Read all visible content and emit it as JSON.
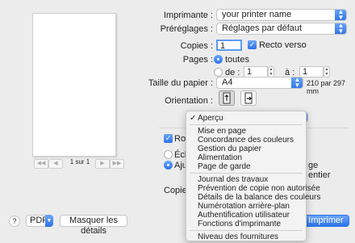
{
  "preview": {
    "page_label": "1 sur 1",
    "first_label": "◀◀",
    "prev_label": "◀",
    "next_label": "▶",
    "last_label": "▶▶"
  },
  "printer": {
    "label": "Imprimante :",
    "value": "your printer name"
  },
  "presets": {
    "label": "Préréglages :",
    "value": "Réglages par défaut"
  },
  "copies": {
    "label": "Copies :",
    "value": "1",
    "duplex_label": "Recto verso",
    "duplex_checked": true
  },
  "pages": {
    "label": "Pages :",
    "all_label": "toutes",
    "from_label": "de :",
    "from_value": "1",
    "to_label": "à :",
    "to_value": "1"
  },
  "paper": {
    "label": "Taille du papier :",
    "value": "A4",
    "dimensions": "210 par 297 mm"
  },
  "orientation": {
    "label": "Orientation :"
  },
  "behind": {
    "rotate_label": "Rotati",
    "scale_label": "Échel",
    "fit_label": "Ajust",
    "page_frag": "ge",
    "whole_frag": "entier",
    "copies_per_label": "Copies p"
  },
  "menu": {
    "checked_item": "Aperçu",
    "check_mark": "✓",
    "group1": [
      "Mise en page",
      "Concordance des couleurs",
      "Gestion du papier",
      "Alimentation",
      "Page de garde"
    ],
    "group2": [
      "Journal des travaux",
      "Prévention de copie non autorisée",
      "Détails de la balance des couleurs",
      "Numérotation arrière-plan",
      "Authentification utilisateur",
      "Fonctions d'imprimante"
    ],
    "group3": [
      "Niveau des fournitures"
    ]
  },
  "footer": {
    "help_label": "?",
    "pdf_label": "PDF",
    "hide_details_label": "Masquer les détails",
    "print_label": "Imprimer"
  },
  "colors": {
    "accent": "#2e73e8",
    "window_bg": "#ececec"
  }
}
